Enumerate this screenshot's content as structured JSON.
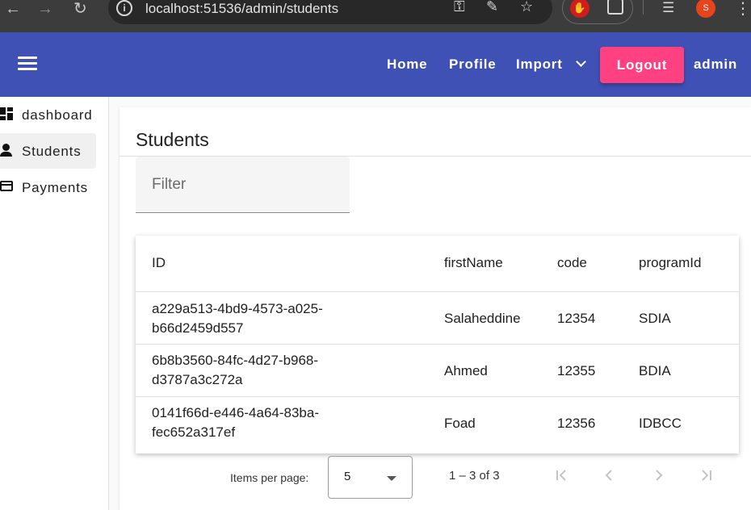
{
  "browser": {
    "url": "localhost:51536/admin/students",
    "avatar_letter": "S"
  },
  "toolbar": {
    "home": "Home",
    "profile": "Profile",
    "import": "Import",
    "logout": "Logout",
    "user": "admin",
    "color": "#3f51b5",
    "logout_color": "#ff4081"
  },
  "sidebar": {
    "items": [
      {
        "label": "dashboard",
        "icon": "dashboard-icon"
      },
      {
        "label": "Students",
        "icon": "person-icon",
        "active": true
      },
      {
        "label": "Payments",
        "icon": "credit-card-icon"
      }
    ]
  },
  "main": {
    "title": "Students",
    "filter_placeholder": "Filter",
    "columns": [
      "ID",
      "firstName",
      "code",
      "programId"
    ],
    "rows": [
      {
        "id_line1": "a229a513-4bd9-4573-a025-",
        "id_line2": "b66d2459d557",
        "firstName": "Salaheddine",
        "code": "12354",
        "programId": "SDIA"
      },
      {
        "id_line1": "6b8b3560-84fc-4d27-b968-",
        "id_line2": "d3787a3c272a",
        "firstName": "Ahmed",
        "code": "12355",
        "programId": "BDIA"
      },
      {
        "id_line1": "0141f66d-e446-4a64-83ba-",
        "id_line2": "fec652a317ef",
        "firstName": "Foad",
        "code": "12356",
        "programId": "IDBCC"
      }
    ]
  },
  "paginator": {
    "items_per_page_label": "Items per page:",
    "page_size": "5",
    "range": "1 – 3 of 3"
  }
}
